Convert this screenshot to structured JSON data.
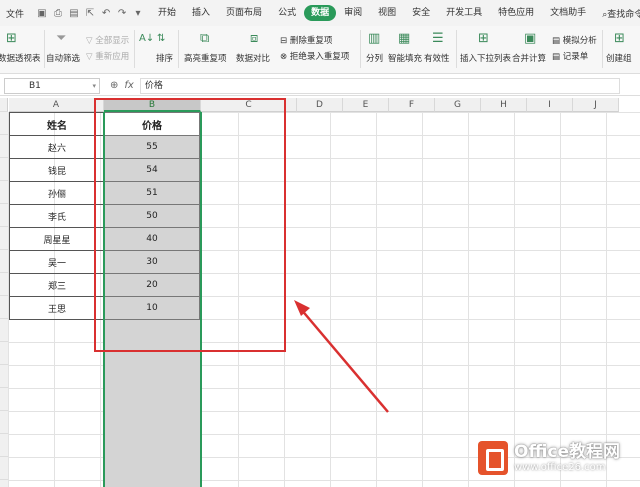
{
  "menu": {
    "file_label": "文件",
    "tabs": [
      "开始",
      "插入",
      "页面布局",
      "公式",
      "数据",
      "审阅",
      "视图",
      "安全",
      "开发工具",
      "特色应用",
      "文档助手"
    ],
    "active_tab": "数据",
    "search_label": "查找命令..."
  },
  "ribbon": {
    "pivot": "数据透视表",
    "auto_filter": "自动筛选",
    "show_all": "全部显示",
    "reapply": "重新应用",
    "sort": "排序",
    "highlight_dup": "高亮重复项",
    "data_compare": "数据对比",
    "remove_dup": "删除重复项",
    "reject_dup": "拒绝录入重复项",
    "split": "分列",
    "smart_fill": "智能填充",
    "validity": "有效性",
    "insert_dropdown": "插入下拉列表",
    "consolidate": "合并计算",
    "what_if": "模拟分析",
    "record": "记录单",
    "create_group": "创建组"
  },
  "formula_bar": {
    "cell_ref": "B1",
    "fx": "fx",
    "content": "价格"
  },
  "columns": [
    "A",
    "B",
    "C",
    "D",
    "E",
    "F",
    "G",
    "H",
    "I",
    "J"
  ],
  "selected_column": "B",
  "table": {
    "headers": [
      "姓名",
      "价格"
    ],
    "rows": [
      [
        "赵六",
        "55"
      ],
      [
        "钱昆",
        "54"
      ],
      [
        "孙俪",
        "51"
      ],
      [
        "李氏",
        "50"
      ],
      [
        "周星星",
        "40"
      ],
      [
        "吴一",
        "30"
      ],
      [
        "郑三",
        "20"
      ],
      [
        "王思",
        "10"
      ]
    ]
  },
  "watermark": {
    "title": "Office教程网",
    "url": "www.office26.com"
  },
  "colors": {
    "accent": "#2a9a5a",
    "highlight_box": "#d93030",
    "selection_fill": "#d4d4d4",
    "watermark_logo": "#e5532b"
  }
}
